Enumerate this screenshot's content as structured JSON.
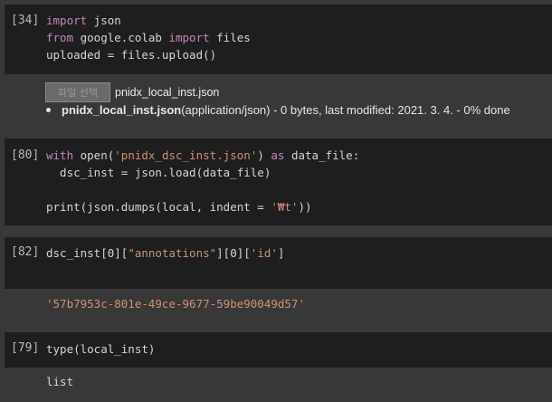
{
  "cells": [
    {
      "prompt": "[34]",
      "lines": [
        {
          "kw1": "import",
          "rest1": " json"
        },
        {
          "kw1": "from",
          "mid": " google.colab ",
          "kw2": "import",
          "rest2": " files"
        },
        {
          "text": "uploaded = files.upload()"
        }
      ],
      "upload": {
        "button_label": "파일 선택",
        "selected_file": "pnidx_local_inst.json",
        "list_item": {
          "name": "pnidx_local_inst.json",
          "details": "(application/json) - 0 bytes, last modified: 2021. 3. 4. - 0% done"
        }
      }
    },
    {
      "prompt": "[80]",
      "lines": [
        {
          "kw": "with",
          "a": " open(",
          "str": "'pnidx_dsc_inst.json'",
          "b": ") ",
          "kw2": "as",
          "c": " data_file:"
        },
        {
          "text": "  dsc_inst = json.load(data_file)"
        },
        {
          "text": ""
        },
        {
          "pre": "print(json.dumps(local, indent = ",
          "str": "'₩t'",
          "post": "))"
        }
      ]
    },
    {
      "prompt": "[82]",
      "code": {
        "a": "dsc_inst[0][",
        "s1": "\"annotations\"",
        "b": "][0][",
        "s2": "'id'",
        "c": "]"
      },
      "output": "'57b7953c-801e-49ce-9677-59be90049d57'"
    },
    {
      "prompt": "[79]",
      "code_text": "type(local_inst)",
      "output": "list"
    }
  ]
}
